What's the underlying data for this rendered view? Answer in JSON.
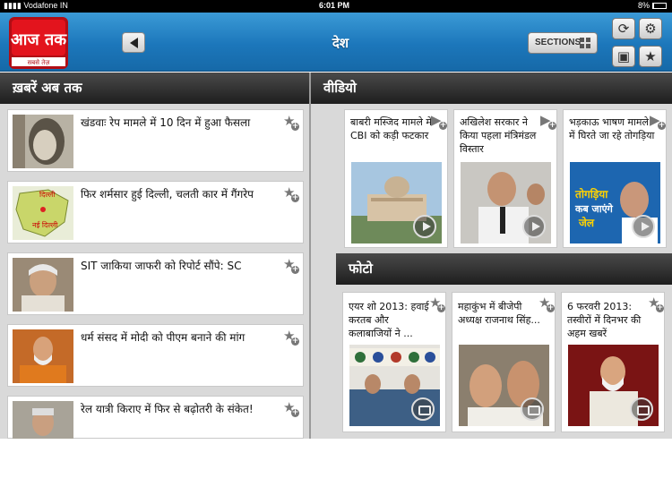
{
  "status": {
    "carrier": "Vodafone IN",
    "time": "6:01 PM",
    "battery": "8%"
  },
  "header": {
    "logo_text": "आज तक",
    "logo_tagline": "सबसे तेज़",
    "title": "देश",
    "sections_label": "SECTIONS"
  },
  "left_panel": {
    "title": "ख़बरें अब तक",
    "items": [
      {
        "text": "खंडवाः रेप मामले में 10 दिन में हुआ फैसला"
      },
      {
        "text": "फिर शर्मसार हुई दिल्ली, चलती कार में गैंगरेप",
        "map_label_top": "दिल्ली",
        "map_label_bottom": "नई दिल्ली"
      },
      {
        "text": "SIT जाकिया जाफरी को रिपोर्ट सौंपे: SC"
      },
      {
        "text": "धर्म संसद में मोदी को पीएम बनाने की मांग"
      },
      {
        "text": "रेल यात्री किराए में फिर से बढ़ोतरी के संकेत!"
      }
    ]
  },
  "video_panel": {
    "title": "वीडियो",
    "items": [
      {
        "text": "बाबरी मस्जिद मामले में CBI को कड़ी फटकार"
      },
      {
        "text": "अखिलेश सरकार ने किया पहला मंत्रिमंडल विस्तार"
      },
      {
        "text": "भड़काऊ भाषण मामले में घिरते जा रहे तोगड़िया",
        "overlay_line1": "तोगड़िया",
        "overlay_line2": "कब जाएंगे",
        "overlay_line3": "जेल"
      }
    ]
  },
  "photo_panel": {
    "title": "फोटो",
    "items": [
      {
        "text": "एयर शो 2013: हवाई करतब और कलाबाजियों ने ..."
      },
      {
        "text": "महाकुंभ में बीजेपी अध्यक्ष राजनाथ सिंह..."
      },
      {
        "text": "6 फरवरी 2013: तस्वीरों में दिनभर की अहम खबरें"
      }
    ]
  },
  "colors": {
    "header_blue": "#1c77bb",
    "panel_dark": "#2a2a2a",
    "logo_red": "#d6121b"
  },
  "icons": [
    "back-arrow-icon",
    "grid-icon",
    "refresh-icon",
    "settings-icon",
    "video-icon",
    "star-icon",
    "add-favorite-icon",
    "play-icon",
    "camera-icon"
  ]
}
